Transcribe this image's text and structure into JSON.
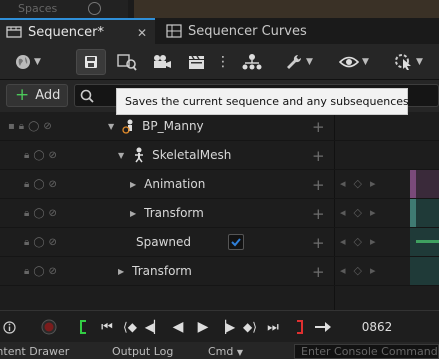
{
  "background": {
    "ghost_text": "Spaces"
  },
  "tabs": [
    {
      "label": "Sequencer*",
      "active": true
    },
    {
      "label": "Sequencer Curves",
      "active": false
    }
  ],
  "toolbar": {
    "icons": [
      "world-icon",
      "save-icon",
      "find-asset-icon",
      "camera-icon",
      "clapper-icon",
      "more-vert-icon",
      "hierarchy-icon",
      "wrench-icon",
      "eye-icon",
      "cursor-gear-icon"
    ]
  },
  "add_button": {
    "label": "Add"
  },
  "search": {
    "placeholder": ""
  },
  "tooltip": {
    "text": "Saves the current sequence and any subsequences"
  },
  "tracks": [
    {
      "label": "BP_Manny",
      "indent": 1,
      "expanded": true,
      "icon": "actor-icon"
    },
    {
      "label": "SkeletalMesh",
      "indent": 2,
      "expanded": true,
      "icon": "skeleton-icon"
    },
    {
      "label": "Animation",
      "indent": 3,
      "expanded": false
    },
    {
      "label": "Transform",
      "indent": 3,
      "expanded": false
    },
    {
      "label": "Spawned",
      "indent": 2,
      "checked": true
    },
    {
      "label": "Transform",
      "indent": 2,
      "expanded": false
    }
  ],
  "transport": {
    "frame": "0862"
  },
  "statusbar": {
    "content_drawer": "Content Drawer",
    "output_log": "Output Log",
    "cmd": "Cmd",
    "console_placeholder": "Enter Console Command"
  },
  "colors": {
    "accent": "#2f8fd8",
    "add_plus": "#4cc85a",
    "play_start_marker": "#33cc44",
    "play_end_marker": "#e03030",
    "checkbox": "#2f7fd8"
  }
}
